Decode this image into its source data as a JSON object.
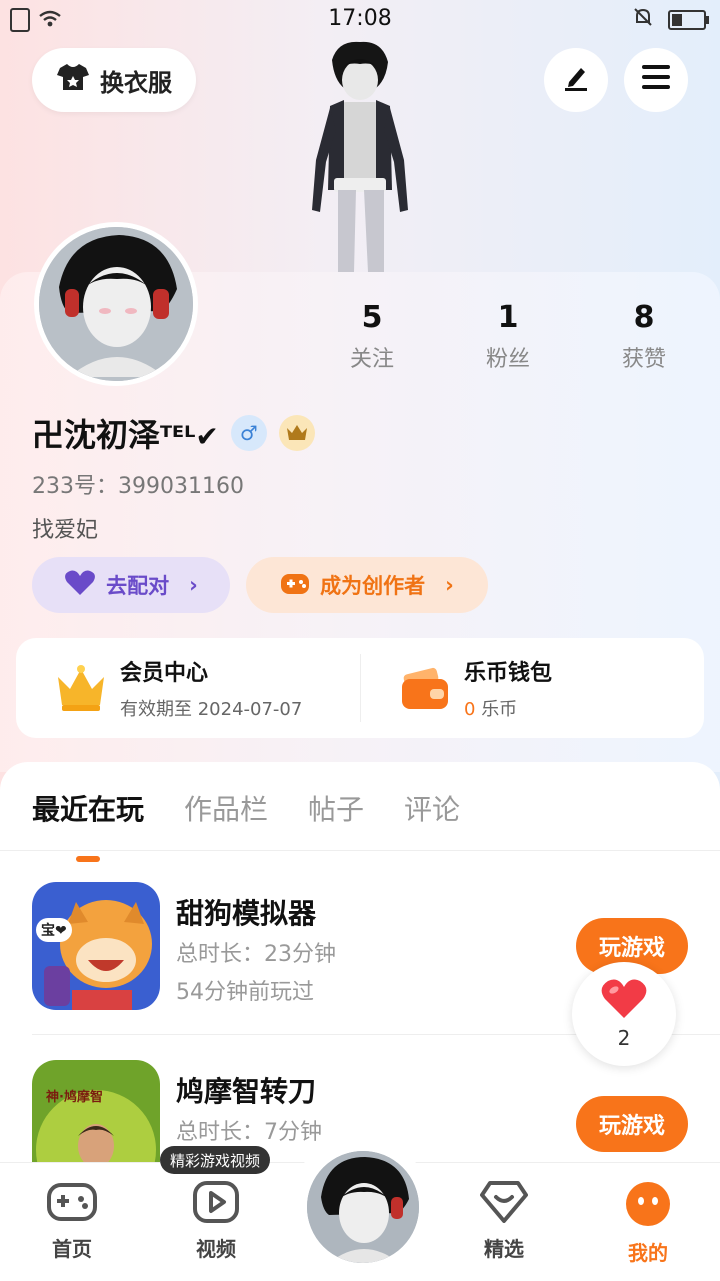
{
  "status_bar": {
    "time": "17:08"
  },
  "header": {
    "outfit_label": "换衣服"
  },
  "profile": {
    "stats": [
      {
        "value": "5",
        "label": "关注"
      },
      {
        "value": "1",
        "label": "粉丝"
      },
      {
        "value": "8",
        "label": "获赞"
      }
    ],
    "username": "卍沈初泽",
    "username_suffix": "ᵀᴱᴸ✔",
    "uid": "233号：399031160",
    "bio": "找爱妃",
    "match_label": "去配对",
    "creator_label": "成为创作者"
  },
  "member": {
    "title": "会员中心",
    "subtitle": "有效期至 2024-07-07"
  },
  "wallet": {
    "title": "乐币钱包",
    "amount": "0",
    "unit": "乐币"
  },
  "tabs": [
    {
      "label": "最近在玩"
    },
    {
      "label": "作品栏"
    },
    {
      "label": "帖子"
    },
    {
      "label": "评论"
    }
  ],
  "games": [
    {
      "name": "甜狗模拟器",
      "duration": "总时长：23分钟",
      "last_played": "54分钟前玩过",
      "button": "玩游戏",
      "icon_text": "宝❤"
    },
    {
      "name": "鸠摩智转刀",
      "duration": "总时长：7分钟",
      "button": "玩游戏",
      "icon_text": "神·鸠摩智"
    }
  ],
  "like": {
    "count": "2"
  },
  "video_tip": "精彩游戏视频",
  "nav": [
    {
      "label": "首页"
    },
    {
      "label": "视频"
    },
    {
      "label": "精选"
    },
    {
      "label": "我的"
    }
  ],
  "colors": {
    "accent": "#f8741a",
    "match": "#6a4bc9",
    "creator_bg": "#fde6d6"
  }
}
